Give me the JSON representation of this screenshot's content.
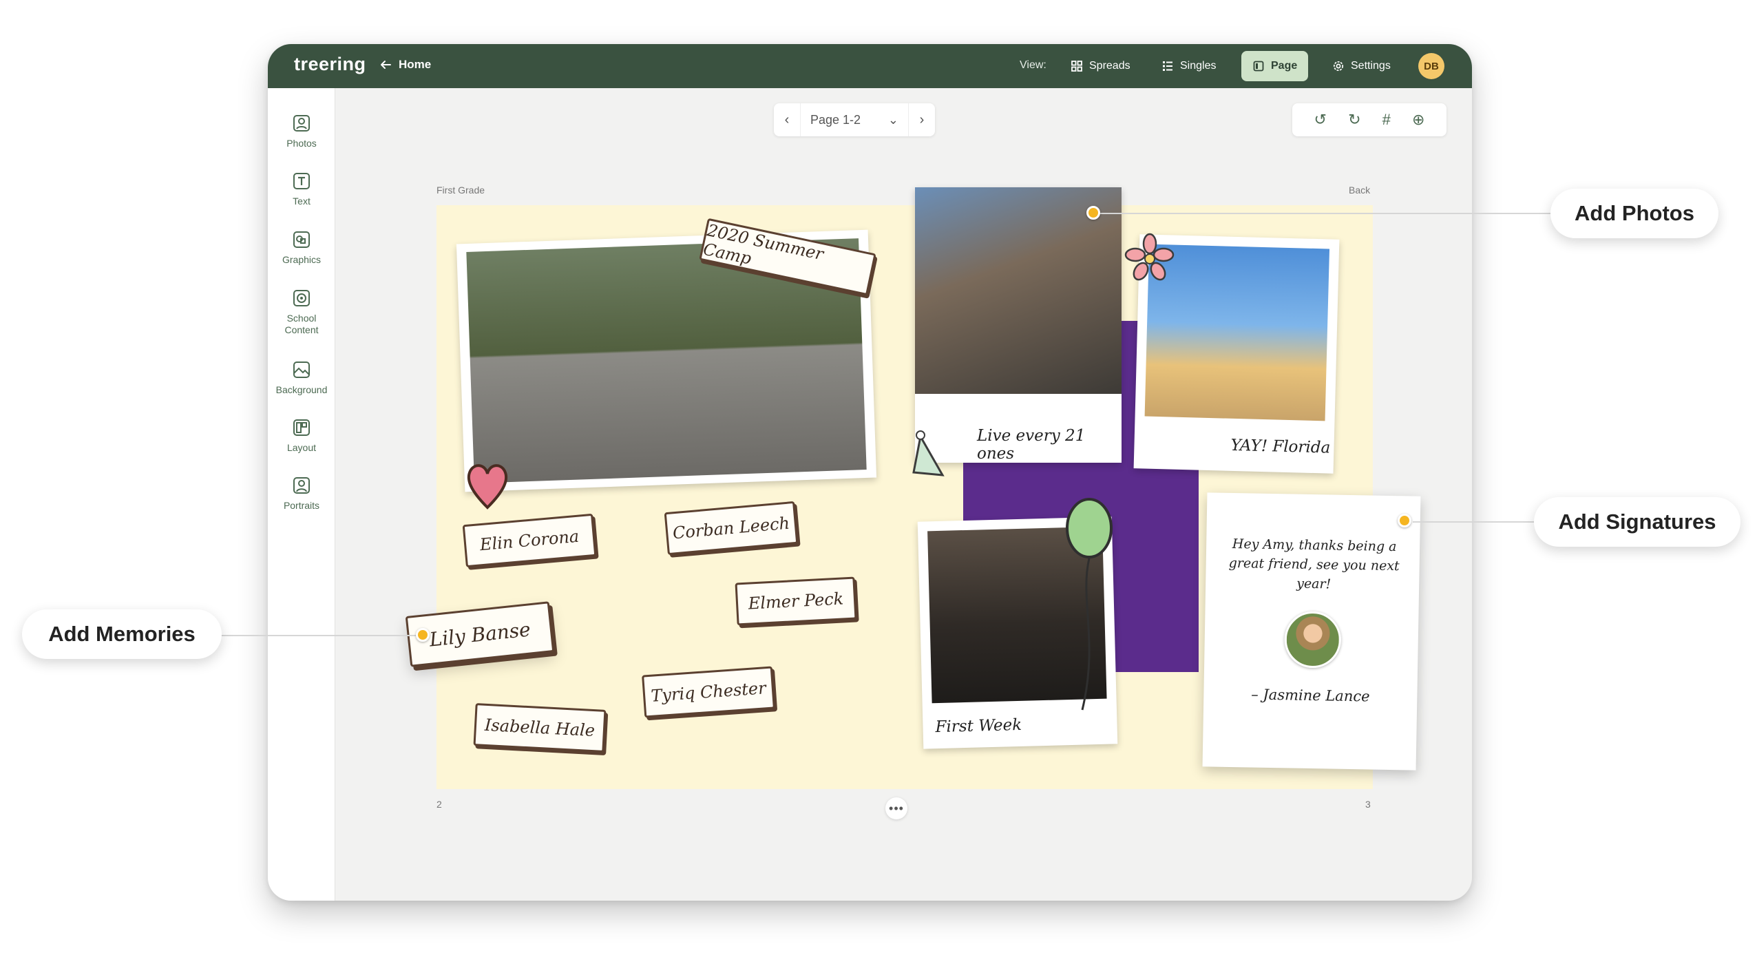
{
  "topbar": {
    "logo": "treering",
    "home_label": "Home",
    "view_label": "View:",
    "views": [
      {
        "label": "Spreads",
        "icon": "grid-icon"
      },
      {
        "label": "Singles",
        "icon": "list-icon"
      },
      {
        "label": "Page",
        "icon": "page-icon",
        "active": true
      },
      {
        "label": "Settings",
        "icon": "gear-icon"
      }
    ],
    "avatar_initials": "DB"
  },
  "sidebar": {
    "items": [
      {
        "label": "Photos",
        "icon": "photo-icon"
      },
      {
        "label": "Text",
        "icon": "text-icon"
      },
      {
        "label": "Graphics",
        "icon": "graphics-icon"
      },
      {
        "label": "School Content",
        "icon": "school-content-icon"
      },
      {
        "label": "Background",
        "icon": "background-icon"
      },
      {
        "label": "Layout",
        "icon": "layout-icon"
      },
      {
        "label": "Portraits",
        "icon": "portraits-icon"
      }
    ]
  },
  "pager": {
    "current": "Page 1-2"
  },
  "toolbox": {
    "icons": [
      "undo-icon",
      "redo-icon",
      "grid-hash-icon",
      "zoom-in-icon"
    ]
  },
  "spread": {
    "left_label": "First Grade",
    "right_label": "Back",
    "left_page_number": "2",
    "right_page_number": "3",
    "camp_banner": "2020 Summer Camp",
    "names": [
      "Elin Corona",
      "Corban Leech",
      "Elmer Peck",
      "Lily Banse",
      "Tyriq Chester",
      "Isabella Hale"
    ],
    "captions": {
      "photo1": "Live every 21 ones",
      "photo2": "YAY! Florida",
      "photo3": "First Week"
    },
    "signature": {
      "message": "Hey Amy, thanks being a great friend, see you next year!",
      "name": "– Jasmine Lance"
    }
  },
  "callouts": {
    "photos": "Add Photos",
    "signatures": "Add Signatures",
    "memories": "Add Memories"
  },
  "colors": {
    "topbar": "#3a5240",
    "accent_active": "#cfe3c9",
    "spread_bg": "#fdf6d6",
    "purple_panel": "#5b2c8c",
    "dot": "#f5b521"
  }
}
